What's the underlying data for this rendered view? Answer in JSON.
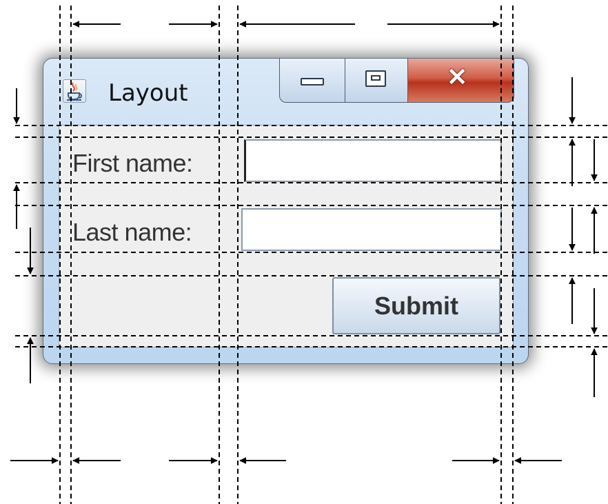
{
  "window": {
    "title": "Layout",
    "icon": "java-cup-icon",
    "controls": {
      "minimize": "minimize-icon",
      "maximize": "maximize-icon",
      "close": "close-icon"
    }
  },
  "form": {
    "first_name_label": "First name:",
    "first_name_value": "",
    "last_name_label": "Last name:",
    "last_name_value": "",
    "submit_label": "Submit"
  },
  "colors": {
    "guide_lines": "#000000",
    "close_button": "#c94a33",
    "window_frame": "#c6dcf2"
  }
}
